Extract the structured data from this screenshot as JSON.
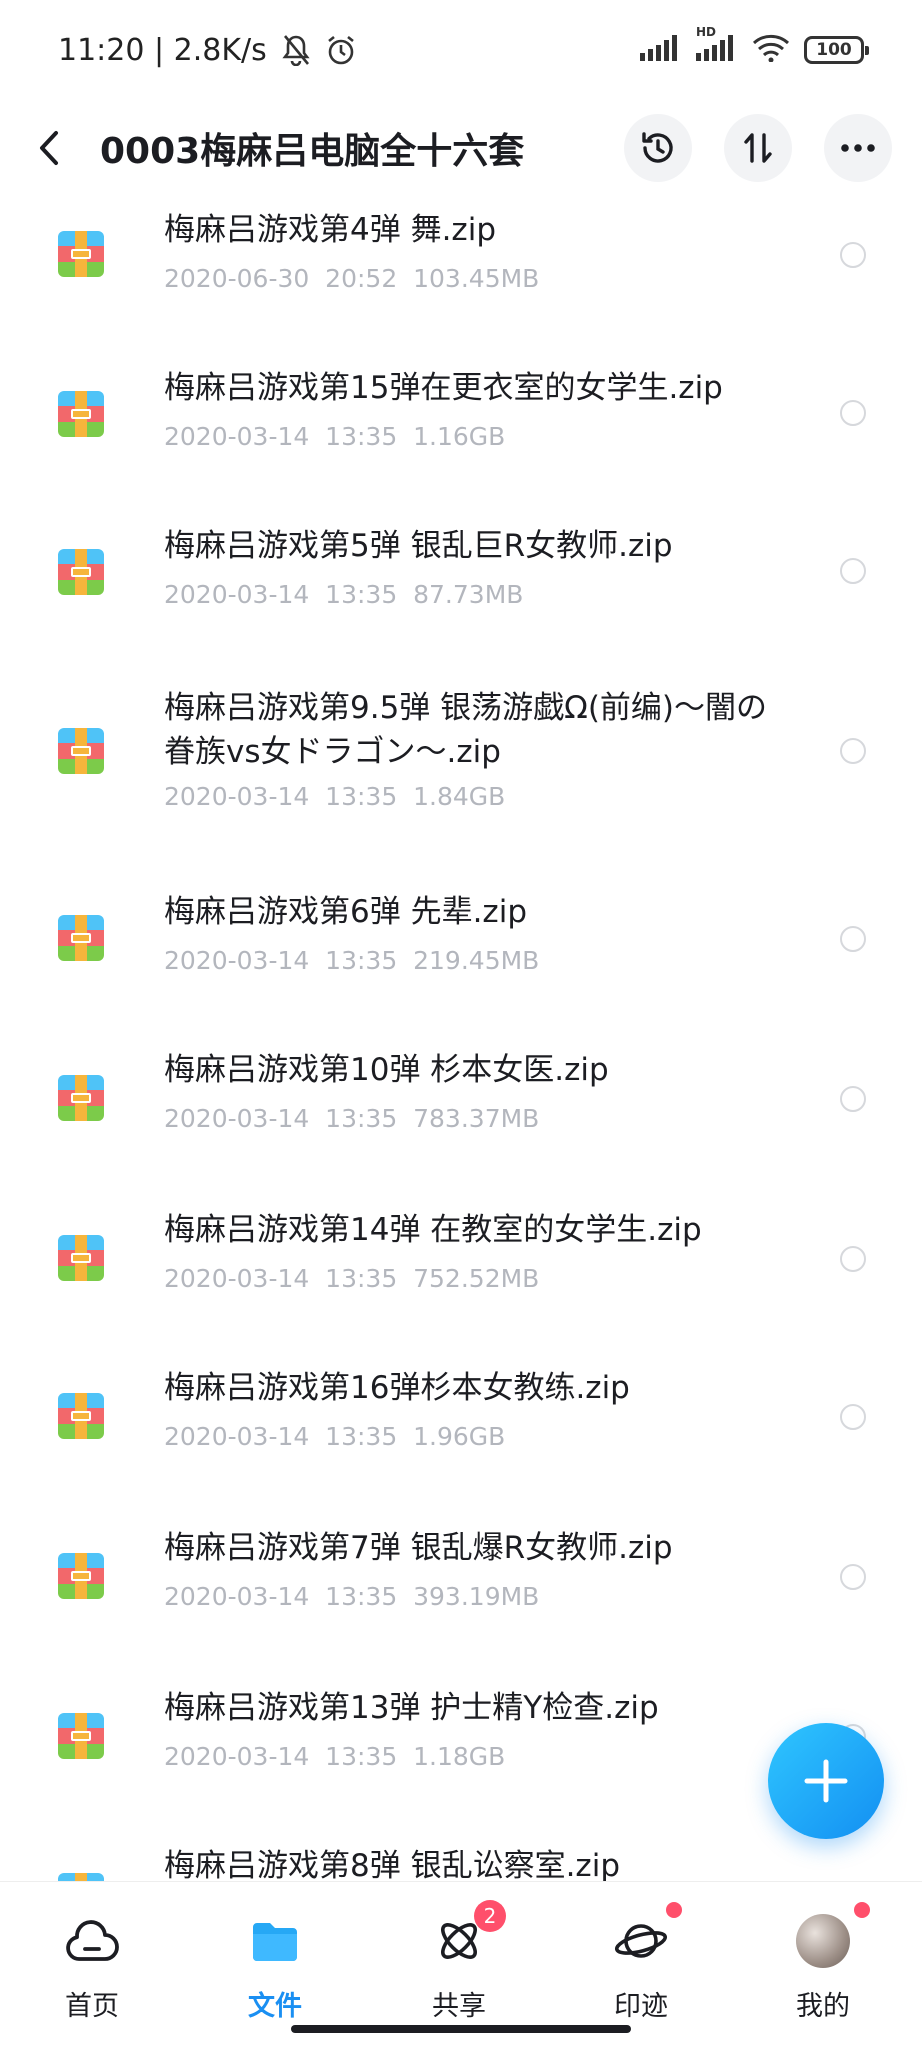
{
  "status_bar": {
    "time_speed": "11:20 | 2.8K/s",
    "battery": "100",
    "network_label": "HD"
  },
  "header": {
    "title": "0003梅麻吕电脑全十六套"
  },
  "files": [
    {
      "name": "梅麻吕游戏第4弹 舞.zip",
      "meta": "2020-06-30  20:52  103.45MB"
    },
    {
      "name": "梅麻吕游戏第15弹在更衣室的女学生.zip",
      "meta": "2020-03-14  13:35  1.16GB"
    },
    {
      "name": "梅麻吕游戏第5弹 银乱巨R女教师.zip",
      "meta": "2020-03-14  13:35  87.73MB"
    },
    {
      "name": "梅麻吕游戏第9.5弹 银荡游戯Ω(前编)～闇の眷族vs女ドラゴン～.zip",
      "meta": "2020-03-14  13:35  1.84GB"
    },
    {
      "name": "梅麻吕游戏第6弹 先辈.zip",
      "meta": "2020-03-14  13:35  219.45MB"
    },
    {
      "name": "梅麻吕游戏第10弹 杉本女医.zip",
      "meta": "2020-03-14  13:35  783.37MB"
    },
    {
      "name": "梅麻吕游戏第14弹 在教室的女学生.zip",
      "meta": "2020-03-14  13:35  752.52MB"
    },
    {
      "name": "梅麻吕游戏第16弹杉本女教练.zip",
      "meta": "2020-03-14  13:35  1.96GB"
    },
    {
      "name": "梅麻吕游戏第7弹 银乱爆R女教师.zip",
      "meta": "2020-03-14  13:35  393.19MB"
    },
    {
      "name": "梅麻吕游戏第13弹 护士精Y检查.zip",
      "meta": "2020-03-14  13:35  1.18GB"
    },
    {
      "name": "梅麻吕游戏第8弹 银乱讼察室.zip",
      "meta": ""
    }
  ],
  "bottom_nav": {
    "home": "首页",
    "files": "文件",
    "share": "共享",
    "share_badge": "2",
    "trace": "印迹",
    "mine": "我的"
  },
  "colors": {
    "accent": "#1a8ff2",
    "badge": "#ff4f6b",
    "meta_text": "#b3b6bd"
  }
}
